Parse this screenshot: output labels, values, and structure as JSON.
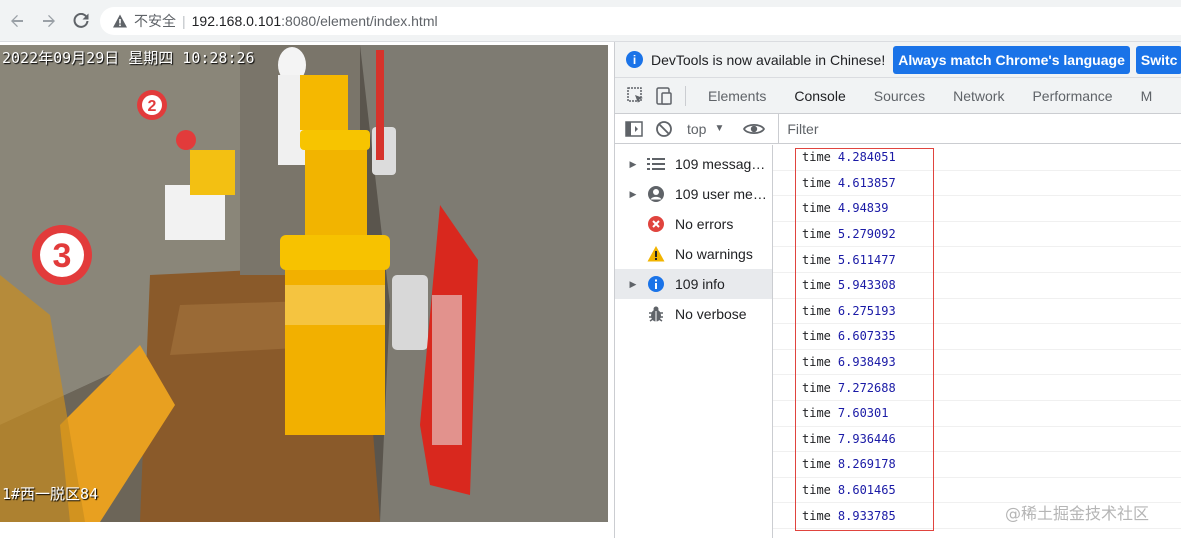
{
  "browser": {
    "insecure_label": "不安全",
    "separator": "|",
    "url_host": "192.168.0.101",
    "url_path": ":8080/element/index.html"
  },
  "video": {
    "timestamp": "2022年09月29日 星期四 10:28:26",
    "camera_label": "1#西一脱区84"
  },
  "devtools": {
    "infobar_text": "DevTools is now available in Chinese!",
    "match_button": "Always match Chrome's language",
    "switch_button": "Switc",
    "tabs": [
      "Elements",
      "Console",
      "Sources",
      "Network",
      "Performance",
      "M"
    ],
    "context": "top",
    "filter_placeholder": "Filter",
    "sidebar": [
      {
        "label": "109 messag…",
        "icon": "list-icon",
        "expandable": true
      },
      {
        "label": "109 user me…",
        "icon": "user-icon",
        "expandable": true
      },
      {
        "label": "No errors",
        "icon": "error-icon",
        "expandable": false
      },
      {
        "label": "No warnings",
        "icon": "warning-icon",
        "expandable": false
      },
      {
        "label": "109 info",
        "icon": "info-icon",
        "expandable": true
      },
      {
        "label": "No verbose",
        "icon": "bug-icon",
        "expandable": false
      }
    ],
    "logs": [
      {
        "key": "time",
        "value": "4.284051"
      },
      {
        "key": "time",
        "value": "4.613857"
      },
      {
        "key": "time",
        "value": "4.94839"
      },
      {
        "key": "time",
        "value": "5.279092"
      },
      {
        "key": "time",
        "value": "5.611477"
      },
      {
        "key": "time",
        "value": "5.943308"
      },
      {
        "key": "time",
        "value": "6.275193"
      },
      {
        "key": "time",
        "value": "6.607335"
      },
      {
        "key": "time",
        "value": "6.938493"
      },
      {
        "key": "time",
        "value": "7.272688"
      },
      {
        "key": "time",
        "value": "7.60301"
      },
      {
        "key": "time",
        "value": "7.936446"
      },
      {
        "key": "time",
        "value": "8.269178"
      },
      {
        "key": "time",
        "value": "8.601465"
      },
      {
        "key": "time",
        "value": "8.933785"
      }
    ]
  },
  "watermark": "@稀土掘金技术社区",
  "colors": {
    "accent": "#1a73e8",
    "highlight": "#e0443e",
    "log_value": "#1a1aa6"
  }
}
